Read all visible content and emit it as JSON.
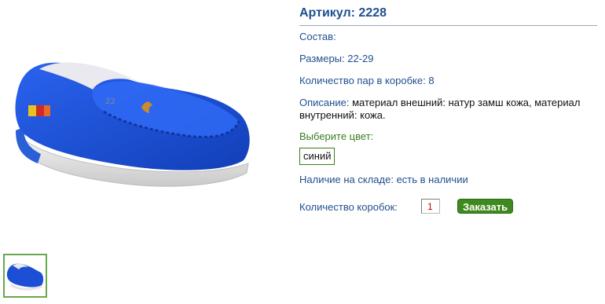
{
  "product": {
    "title": "Артикул: 2228",
    "composition_label": "Состав:",
    "sizes_label": "Размеры:",
    "sizes_value": "22-29",
    "pairs_label": "Количество пар в коробке:",
    "pairs_value": "8",
    "description_label": "Описание:",
    "description_text": "материал внешний: натур замш кожа, материал внутренний: кожа.",
    "choose_color_label": "Выберите цвет:",
    "color_option": "синий",
    "stock_label": "Наличие на складе:",
    "stock_value": "есть в наличии",
    "box_qty_label": "Количество коробок:",
    "box_qty_value": "1",
    "order_button": "Заказать",
    "emblem_text": "22"
  },
  "colors": {
    "label_blue": "#1f4f8f",
    "green": "#3a7d1f",
    "button_green": "#3f8a1f",
    "shoe_blue": "#1d4fd6"
  },
  "icons": {
    "main": "shoe-photo",
    "thumbnail": "shoe-thumbnail"
  }
}
